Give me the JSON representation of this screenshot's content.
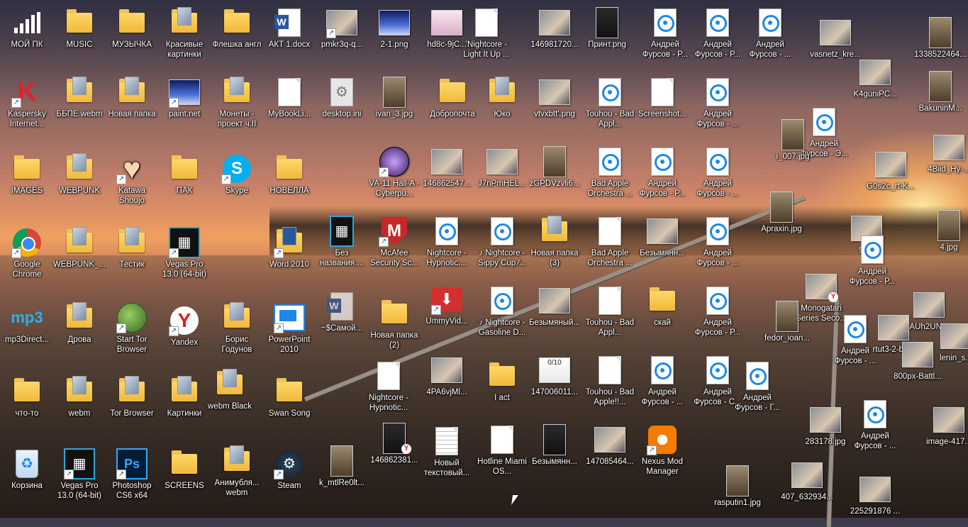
{
  "desktop": {
    "icons": [
      {
        "label": "МОЙ ПК"
      },
      {
        "label": "MUSIC"
      },
      {
        "label": "МУЗЫЧКА"
      },
      {
        "label": "Красивые картинки"
      },
      {
        "label": "Флешка англ"
      },
      {
        "label": "АКТ 1.docx"
      },
      {
        "label": "pmkr3q-q..."
      },
      {
        "label": "2-1.png"
      },
      {
        "label": "hd8c-9jC..."
      },
      {
        "label": "'Nightcore - Light It Up ..."
      },
      {
        "label": "146981720..."
      },
      {
        "label": "Принт.png"
      },
      {
        "label": "Андрей Фурсов - Р..."
      },
      {
        "label": "Андрей Фурсов - Р..."
      },
      {
        "label": "Андрей Фурсов - ..."
      },
      {
        "label": "vasnetz_kre..."
      },
      {
        "label": "1338522464..."
      },
      {
        "label": "Kaspersky Internet..."
      },
      {
        "label": "ББПЕ webm"
      },
      {
        "label": "Новая папка"
      },
      {
        "label": "paint.net"
      },
      {
        "label": "Монеты - проект ч.II"
      },
      {
        "label": "MyBookLi..."
      },
      {
        "label": "desktop.ini"
      },
      {
        "label": "ivan_3.jpg"
      },
      {
        "label": "Добропочта"
      },
      {
        "label": "Юко"
      },
      {
        "label": "vtvxbtt'.png"
      },
      {
        "label": "Touhou - Bad Appl..."
      },
      {
        "label": "Screenshot..."
      },
      {
        "label": "Андрей Фурсов - ..."
      },
      {
        "label": "K4guniPC..."
      },
      {
        "label": "BakuninM..."
      },
      {
        "label": "IMAGES"
      },
      {
        "label": "WEBPUNK"
      },
      {
        "label": "Katawa Shoujo"
      },
      {
        "label": "ПАК"
      },
      {
        "label": "Skype"
      },
      {
        "label": "НОВЕЛЛА"
      },
      {
        "label": "VA-11 Hall-A - Cyberpu..."
      },
      {
        "label": "146862547..."
      },
      {
        "label": "J7nPmHEL..."
      },
      {
        "label": "zGPDVzvli6..."
      },
      {
        "label": "Bad Apple Orchestra ..."
      },
      {
        "label": "Андрей Фурсов - Р..."
      },
      {
        "label": "Андрей Фурсов - ..."
      },
      {
        "label": "Андрей Фурсов - Э..."
      },
      {
        "label": "i_007.jpg"
      },
      {
        "label": "G0s2c_rt-K..."
      },
      {
        "label": "4Biid_Hy-..."
      },
      {
        "label": "Google Chrome"
      },
      {
        "label": "WEBPUNK_..."
      },
      {
        "label": "Тестик"
      },
      {
        "label": "Vegas Pro 13.0 (64-bit)"
      },
      {
        "label": "Word 2010"
      },
      {
        "label": "Без названия...."
      },
      {
        "label": "McAfee Security Sc..."
      },
      {
        "label": "Nightcore - Hypnotic...."
      },
      {
        "label": "♪ Nightcore - Sippy Cup ⁄..."
      },
      {
        "label": "Новая папка (3)"
      },
      {
        "label": "Bad Apple Orchestra ..."
      },
      {
        "label": "Безымянн..."
      },
      {
        "label": "Андрей Фурсов - ..."
      },
      {
        "label": "Apraxin.jpg"
      },
      {
        "label": "9T..."
      },
      {
        "label": "Андрей Фурсов - Р..."
      },
      {
        "label": "4.jpg"
      },
      {
        "label": "mp3Direct..."
      },
      {
        "label": "Дрова"
      },
      {
        "label": "Start Tor Browser"
      },
      {
        "label": "Yandex"
      },
      {
        "label": "Борис Годунов"
      },
      {
        "label": "PowerPoint 2010"
      },
      {
        "label": "~$Самой..."
      },
      {
        "label": "Новая папка (2)"
      },
      {
        "label": "UmmyVid..."
      },
      {
        "label": "♪ Nightcore - Gasoline D..."
      },
      {
        "label": "Безымяный..."
      },
      {
        "label": "Touhou - Bad Appl..."
      },
      {
        "label": "скай"
      },
      {
        "label": "Андрей Фурсов - Р..."
      },
      {
        "label": "Monogatari Series Seco..."
      },
      {
        "label": "fedor_ioan..."
      },
      {
        "label": "Андрей Фурсов - ..."
      },
      {
        "label": "rtut3-2-bjpg"
      },
      {
        "label": "AUh2UN..."
      },
      {
        "label": "lenin_s..."
      },
      {
        "label": "что-то"
      },
      {
        "label": "webm"
      },
      {
        "label": "Tor Browser"
      },
      {
        "label": "Картинки"
      },
      {
        "label": "webm Black"
      },
      {
        "label": "Swan Song"
      },
      {
        "label": "Nightcore - Hypnotic..."
      },
      {
        "label": "4PA6vjMl..."
      },
      {
        "label": "I act"
      },
      {
        "label": "147006011..."
      },
      {
        "label": "Touhou - Bad Apple!!..."
      },
      {
        "label": "Андрей Фурсов - ..."
      },
      {
        "label": "Андрей Фурсов - С..."
      },
      {
        "label": "Андрей Фурсов - Г..."
      },
      {
        "label": "800px-Battl..."
      },
      {
        "label": "Корзина"
      },
      {
        "label": "Vegas Pro 13.0 (64-bit)"
      },
      {
        "label": "Photoshop CS6 x64"
      },
      {
        "label": "SCREENS"
      },
      {
        "label": "Анимубля... webm"
      },
      {
        "label": "Steam"
      },
      {
        "label": "k_mtlRe0lt..."
      },
      {
        "label": "146862381..."
      },
      {
        "label": "Новый текстовый..."
      },
      {
        "label": "Hotline Miami OS..."
      },
      {
        "label": "Безымянн..."
      },
      {
        "label": "147085464..."
      },
      {
        "label": "Nexus Mod Manager"
      },
      {
        "label": "283178.jpg"
      },
      {
        "label": "Андрей Фурсов - ..."
      },
      {
        "label": "image-417..."
      },
      {
        "label": "407_632934..."
      },
      {
        "label": "rasputin1.jpg"
      },
      {
        "label": "225291876 ..."
      }
    ],
    "badges": {
      "video_counter": "0/10"
    }
  }
}
